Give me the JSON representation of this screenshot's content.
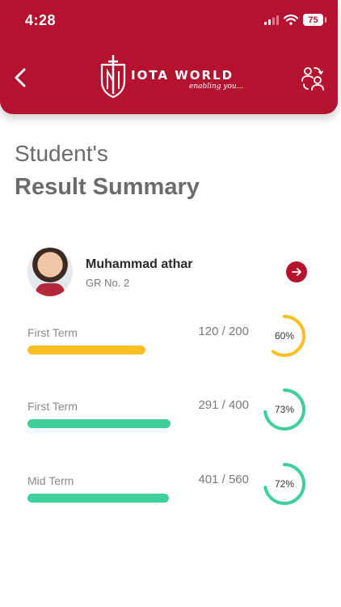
{
  "status_bar": {
    "time": "4:28",
    "battery": "75"
  },
  "header": {
    "logo_text": "IOTA WORLD",
    "logo_tagline": "enabling you...",
    "back_icon": "chevron-left-icon",
    "profile_icon": "switch-user-icon"
  },
  "page": {
    "title_line1": "Student's",
    "title_line2": "Result Summary"
  },
  "student": {
    "name": "Muhammad athar",
    "gr": "GR No. 2",
    "action_icon": "arrow-right-icon"
  },
  "results": [
    {
      "term": "First Term",
      "score": "120 / 200",
      "percent_label": "60%",
      "percent": 60,
      "color": "#fbbf24"
    },
    {
      "term": "First Term",
      "score": "291 / 400",
      "percent_label": "73%",
      "percent": 73,
      "color": "#3ecf9b"
    },
    {
      "term": "Mid Term",
      "score": "401 / 560",
      "percent_label": "72%",
      "percent": 72,
      "color": "#3ecf9b"
    }
  ],
  "colors": {
    "brand": "#b5122f",
    "text_muted": "#8a8a8a"
  }
}
